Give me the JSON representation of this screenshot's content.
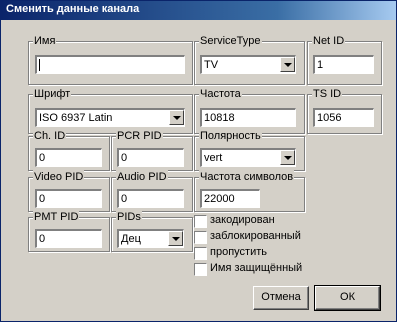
{
  "window": {
    "title": "Сменить данные канала"
  },
  "groups": {
    "name": {
      "label": "Имя",
      "value": ""
    },
    "service_type": {
      "label": "ServiceType",
      "value": "TV"
    },
    "net_id": {
      "label": "Net ID",
      "value": "1"
    },
    "font": {
      "label": "Шрифт",
      "value": "ISO 6937 Latin"
    },
    "frequency": {
      "label": "Частота",
      "value": "10818"
    },
    "ts_id": {
      "label": "TS ID",
      "value": "1056"
    },
    "ch_id": {
      "label": "Ch. ID",
      "value": "0"
    },
    "pcr_pid": {
      "label": "PCR PID",
      "value": "0"
    },
    "polarity": {
      "label": "Полярность",
      "value": "vert"
    },
    "video_pid": {
      "label": "Video PID",
      "value": "0"
    },
    "audio_pid": {
      "label": "Audio PID",
      "value": "0"
    },
    "symbol_rate": {
      "label": "Частота символов",
      "value": "22000"
    },
    "pmt_pid": {
      "label": "PMT PID",
      "value": "0"
    },
    "pids": {
      "label": "PIDs",
      "value": "Дец"
    }
  },
  "checkboxes": [
    {
      "label": "закодирован",
      "checked": false
    },
    {
      "label": "заблокированный",
      "checked": false
    },
    {
      "label": "пропустить",
      "checked": false
    },
    {
      "label": "Имя защищённый",
      "checked": false
    }
  ],
  "buttons": {
    "cancel": "Отмена",
    "ok": "ОК"
  }
}
